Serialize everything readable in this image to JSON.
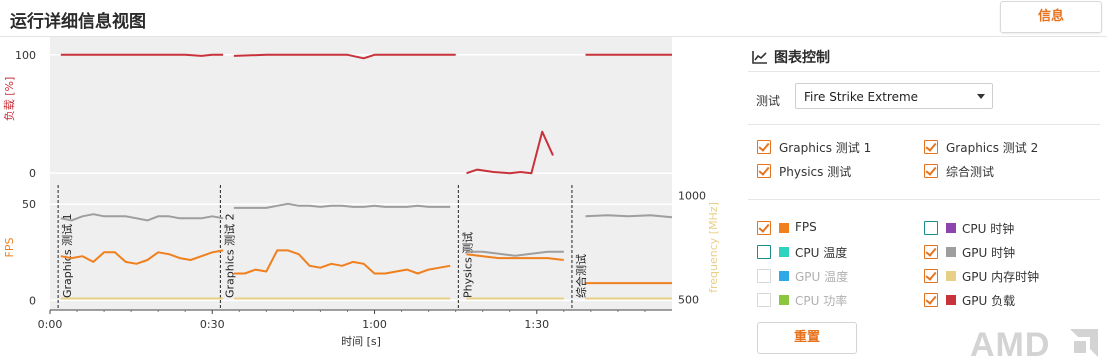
{
  "window": {
    "title": "运行详细信息视图"
  },
  "header": {
    "info_button": "信息"
  },
  "panel": {
    "title": "图表控制",
    "test_label": "测试",
    "test_select": "Fire Strike Extreme",
    "tests": [
      {
        "label": "Graphics 测试 1",
        "checked": true
      },
      {
        "label": "Graphics 测试 2",
        "checked": true
      },
      {
        "label": "Physics 测试",
        "checked": true
      },
      {
        "label": "综合测试",
        "checked": true
      }
    ],
    "series_left": [
      {
        "label": "FPS",
        "checked": true,
        "enabled": true,
        "color": "#f07f1e"
      },
      {
        "label": "CPU 温度",
        "checked": false,
        "enabled": true,
        "color": "#2ed3c0"
      },
      {
        "label": "GPU 温度",
        "checked": false,
        "enabled": false,
        "color": "#2ea8e6"
      },
      {
        "label": "CPU 功率",
        "checked": false,
        "enabled": false,
        "color": "#8cc63f"
      }
    ],
    "series_right": [
      {
        "label": "CPU 时钟",
        "checked": false,
        "enabled": true,
        "color": "#8e44ad"
      },
      {
        "label": "GPU 时钟",
        "checked": true,
        "enabled": true,
        "color": "#9e9e9e"
      },
      {
        "label": "GPU 内存时钟",
        "checked": true,
        "enabled": true,
        "color": "#e8cf86"
      },
      {
        "label": "GPU 负载",
        "checked": true,
        "enabled": true,
        "color": "#c8323a"
      }
    ],
    "reset_button": "重置",
    "brand": "AMD"
  },
  "chart_data": {
    "type": "line",
    "xlabel": "时间 [s]",
    "x_ticks": [
      "0:00",
      "0:30",
      "1:00",
      "1:30"
    ],
    "x_range_s": [
      0,
      115
    ],
    "top_panel": {
      "ylabel": "负载 [%]",
      "y_ticks": [
        "100",
        "0"
      ],
      "ylim": [
        -10,
        115
      ],
      "series": [
        {
          "name": "GPU 负载",
          "color": "#c8323a",
          "segments": [
            {
              "x": [
                2,
                10,
                15,
                20,
                25,
                28,
                30,
                32
              ],
              "y": [
                100,
                100,
                100,
                100,
                100,
                99,
                100,
                100
              ]
            },
            {
              "x": [
                34,
                40,
                45,
                50,
                55,
                58,
                60,
                65,
                70,
                75
              ],
              "y": [
                99,
                100,
                100,
                100,
                100,
                97,
                100,
                100,
                100,
                100
              ]
            },
            {
              "x": [
                77,
                79,
                82,
                85,
                87,
                89,
                91,
                93
              ],
              "y": [
                0,
                3,
                1,
                0,
                1,
                0,
                35,
                15,
                2
              ]
            },
            {
              "x": [
                99,
                105,
                110,
                115
              ],
              "y": [
                100,
                100,
                100,
                100
              ]
            }
          ]
        }
      ]
    },
    "bottom_panel": {
      "ylabel_left": "FPS",
      "y_left_ticks": [
        "50",
        "0"
      ],
      "ylim_left": [
        -5,
        60
      ],
      "ylabel_right": "frequency [MHz]",
      "y_right_ticks": [
        "1000",
        "500"
      ],
      "ylim_right": [
        450,
        1050
      ],
      "section_labels": [
        "Graphics 测试 1",
        "Graphics 测试 2",
        "Physics 测试",
        "综合测试"
      ],
      "section_starts_s": [
        1.5,
        31.5,
        75.5,
        96.5
      ],
      "series": [
        {
          "name": "FPS",
          "axis": "left",
          "color": "#f07f1e",
          "segments": [
            {
              "x": [
                2,
                4,
                6,
                8,
                10,
                12,
                14,
                16,
                18,
                20,
                22,
                24,
                26,
                28,
                30,
                32
              ],
              "y": [
                23,
                22,
                23,
                20,
                25,
                25,
                20,
                19,
                21,
                25,
                24,
                22,
                21,
                23,
                25,
                26
              ]
            },
            {
              "x": [
                34,
                36,
                38,
                40,
                42,
                44,
                46,
                48,
                50,
                52,
                54,
                56,
                58,
                60,
                62,
                64,
                66,
                68,
                70,
                72,
                74
              ],
              "y": [
                14,
                14,
                16,
                15,
                26,
                26,
                24,
                18,
                17,
                19,
                18,
                20,
                19,
                14,
                14,
                15,
                16,
                14,
                16,
                17,
                18
              ]
            },
            {
              "x": [
                77,
                80,
                83,
                86,
                89,
                92,
                95
              ],
              "y": [
                24,
                23,
                22,
                22,
                22,
                22,
                21
              ]
            },
            {
              "x": [
                99,
                103,
                107,
                111,
                115
              ],
              "y": [
                9,
                9,
                9,
                9,
                9
              ]
            }
          ]
        },
        {
          "name": "GPU 时钟",
          "axis": "right",
          "color": "#9e9e9e",
          "segments": [
            {
              "x": [
                2,
                4,
                6,
                8,
                10,
                12,
                14,
                16,
                18,
                20,
                22,
                24,
                26,
                28,
                30,
                32
              ],
              "y": [
                890,
                880,
                900,
                910,
                900,
                900,
                900,
                890,
                880,
                900,
                900,
                890,
                890,
                890,
                900,
                890
              ]
            },
            {
              "x": [
                34,
                36,
                38,
                40,
                42,
                44,
                46,
                48,
                50,
                52,
                54,
                56,
                58,
                60,
                62,
                64,
                66,
                68,
                70,
                72,
                74
              ],
              "y": [
                940,
                940,
                940,
                940,
                950,
                960,
                950,
                950,
                945,
                950,
                950,
                945,
                945,
                950,
                945,
                945,
                945,
                950,
                945,
                945,
                945
              ]
            },
            {
              "x": [
                77,
                80,
                83,
                86,
                89,
                92,
                95
              ],
              "y": [
                730,
                730,
                720,
                710,
                720,
                730,
                730
              ]
            },
            {
              "x": [
                99,
                103,
                107,
                111,
                115
              ],
              "y": [
                900,
                905,
                900,
                905,
                895
              ]
            }
          ]
        },
        {
          "name": "GPU 内存时钟",
          "axis": "right",
          "color": "#e8cf86",
          "segments": [
            {
              "x": [
                2,
                32
              ],
              "y": [
                505,
                505
              ]
            },
            {
              "x": [
                34,
                74
              ],
              "y": [
                505,
                505
              ]
            },
            {
              "x": [
                77,
                95
              ],
              "y": [
                505,
                505
              ]
            },
            {
              "x": [
                99,
                115
              ],
              "y": [
                505,
                505
              ]
            }
          ]
        }
      ]
    }
  }
}
